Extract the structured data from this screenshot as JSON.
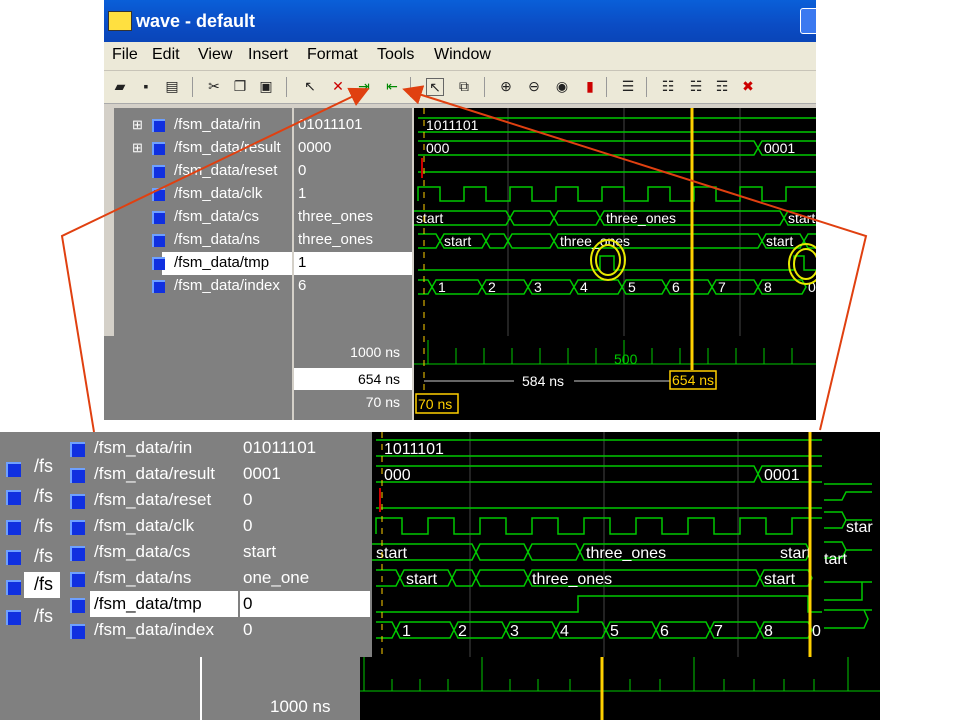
{
  "window": {
    "title": "wave - default"
  },
  "menu": [
    "File",
    "Edit",
    "View",
    "Insert",
    "Format",
    "Tools",
    "Window"
  ],
  "toolbar_icons": [
    "open-icon",
    "save-icon",
    "print-icon",
    "cut-icon",
    "copy-icon",
    "paste-icon",
    "select-icon",
    "delete-cursor-icon",
    "previous-edge-icon",
    "next-edge-icon",
    "pointer-icon",
    "zoom-mode-icon",
    "zoom-in-icon",
    "zoom-out-icon",
    "zoom-full-icon",
    "stop-icon",
    "find-icon",
    "list-icon",
    "insert-icon",
    "add-icon",
    "remove-icon"
  ],
  "signals": [
    {
      "name": "/fsm_data/rin",
      "value": "01011101",
      "expandable": true
    },
    {
      "name": "/fsm_data/result",
      "value": "0000",
      "expandable": true
    },
    {
      "name": "/fsm_data/reset",
      "value": "0",
      "expandable": false
    },
    {
      "name": "/fsm_data/clk",
      "value": "1",
      "expandable": false
    },
    {
      "name": "/fsm_data/cs",
      "value": "three_ones",
      "expandable": false
    },
    {
      "name": "/fsm_data/ns",
      "value": "three_ones",
      "expandable": false
    },
    {
      "name": "/fsm_data/tmp",
      "value": "1",
      "expandable": false,
      "selected": true
    },
    {
      "name": "/fsm_data/index",
      "value": "6",
      "expandable": false
    }
  ],
  "wave_labels": {
    "rin": "1011101",
    "result_a": "000",
    "result_b": "0001",
    "cs_start": "start",
    "cs_three_ones": "three_ones",
    "cs_start2": "start",
    "ns_start": "start",
    "ns_three_ones": "three_ones",
    "ns_start2": "start",
    "index": [
      "1",
      "2",
      "3",
      "4",
      "5",
      "6",
      "7",
      "8",
      "0"
    ]
  },
  "cursors": {
    "now": "1000 ns",
    "cursor1": "654 ns",
    "cursor2": "70 ns",
    "ruler_mark": "500",
    "delta": "584 ns",
    "cursor1_box": "654 ns",
    "cursor2_box": "70 ns"
  },
  "zoom": {
    "behind_labels": [
      "/fs",
      "/fs",
      "/fs",
      "/fs",
      "/fs",
      "/fs"
    ],
    "signals": [
      {
        "name": "/fsm_data/rin",
        "value": "01011101"
      },
      {
        "name": "/fsm_data/result",
        "value": "0001"
      },
      {
        "name": "/fsm_data/reset",
        "value": "0"
      },
      {
        "name": "/fsm_data/clk",
        "value": "0"
      },
      {
        "name": "/fsm_data/cs",
        "value": "start"
      },
      {
        "name": "/fsm_data/ns",
        "value": "one_one"
      },
      {
        "name": "/fsm_data/tmp",
        "value": "0",
        "selected": true
      },
      {
        "name": "/fsm_data/index",
        "value": "0"
      }
    ],
    "wave_labels": {
      "rin": "1011101",
      "result_a": "000",
      "result_b": "0001",
      "cs_start": "start",
      "cs_three_ones": "three_ones",
      "cs_start2": "start",
      "ns_start": "start",
      "ns_three_ones": "three_ones",
      "ns_start2": "start",
      "index": [
        "1",
        "2",
        "3",
        "4",
        "5",
        "6",
        "7",
        "8",
        "0"
      ],
      "side_start": "star",
      "side_start2": "tart"
    },
    "now": "1000 ns"
  },
  "colors": {
    "wave_green": "#00c800",
    "cursor_yellow": "#ffd000",
    "highlight_ring": "#e8e800",
    "annotation_arrow": "#e04010",
    "reset_red": "#d00000"
  }
}
